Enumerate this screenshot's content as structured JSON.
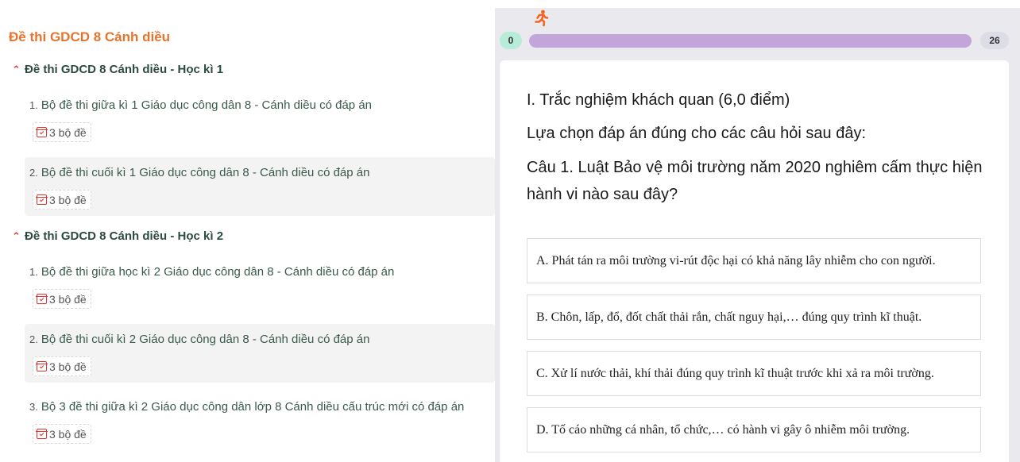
{
  "left": {
    "title": "Đề thi GDCD 8 Cánh diều",
    "sections": [
      {
        "title": "Đề thi GDCD 8 Cánh diều - Học kì 1",
        "items": [
          {
            "num": "1.",
            "label": "Bộ đề thi giữa kì 1 Giáo dục công dân 8 - Cánh diều có đáp án",
            "badge": "3 bộ đề"
          },
          {
            "num": "2.",
            "label": "Bộ đề thi cuối kì 1 Giáo dục công dân 8 - Cánh diều có đáp án",
            "badge": "3 bộ đề"
          }
        ]
      },
      {
        "title": "Đề thi GDCD 8 Cánh diều - Học kì 2",
        "items": [
          {
            "num": "1.",
            "label": "Bộ đề thi giữa học kì 2 Giáo dục công dân 8 - Cánh diều có đáp án",
            "badge": "3 bộ đề"
          },
          {
            "num": "2.",
            "label": "Bộ đề thi cuối kì 2 Giáo dục công dân 8 - Cánh diều có đáp án",
            "badge": "3 bộ đề"
          },
          {
            "num": "3.",
            "label": "Bộ 3 đề thi giữa kì 2 Giáo dục công dân lớp 8 Cánh diều cấu trúc mới có đáp án",
            "badge": "3 bộ đề"
          }
        ]
      }
    ]
  },
  "quiz": {
    "runner_icon": "running-person-icon",
    "progress_start": "0",
    "progress_end": "26",
    "progress_fraction": 1.0,
    "heading": "I. Trắc nghiệm khách quan (6,0 điểm)",
    "instruction": "Lựa chọn đáp án đúng cho các câu hỏi sau đây:",
    "question": "Câu 1. Luật Bảo vệ môi trường năm 2020 nghiêm cấm thực hiện hành vi nào sau đây?",
    "options": [
      "A. Phát tán ra môi trường vi-rút độc hại có khả năng lây nhiễm cho con người.",
      "B. Chôn, lấp, đổ, đốt chất thải rắn, chất nguy hại,… đúng quy trình kĩ thuật.",
      "C. Xử lí nước thải, khí thải đúng quy trình kĩ thuật trước khi xả ra môi trường.",
      "D. Tố cáo những cá nhân, tổ chức,… có hành vi gây ô nhiễm môi trường."
    ]
  },
  "colors": {
    "title_orange": "#e8732c",
    "chevron_red": "#e0332c",
    "progress_fill": "#c3a6d9",
    "start_pill": "#b6ecd8"
  }
}
